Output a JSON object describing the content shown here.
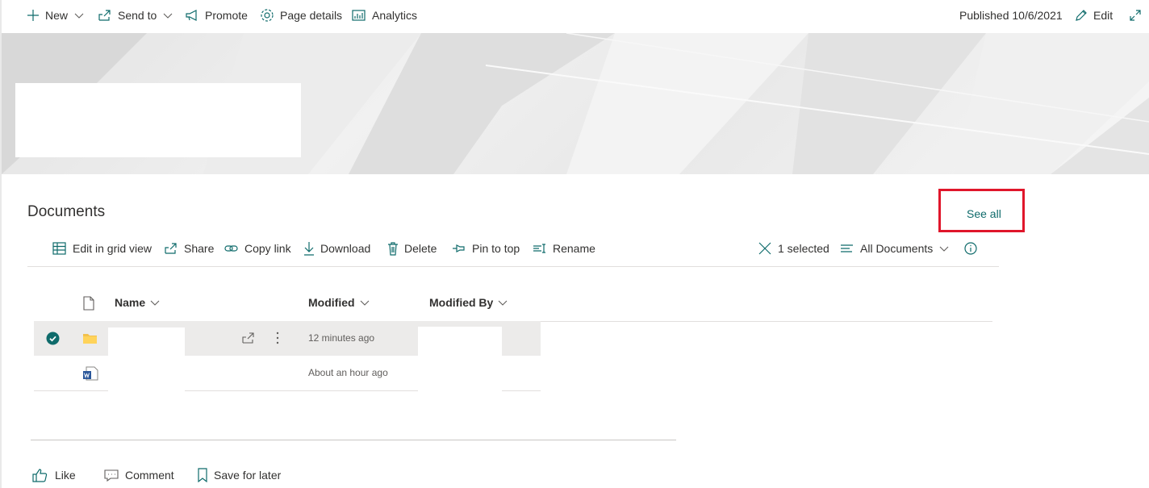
{
  "command_bar": {
    "new_label": "New",
    "send_to_label": "Send to",
    "promote_label": "Promote",
    "page_details_label": "Page details",
    "analytics_label": "Analytics",
    "published_label": "Published 10/6/2021",
    "edit_label": "Edit"
  },
  "documents": {
    "title": "Documents",
    "see_all_label": "See all",
    "toolbar": {
      "edit_grid_label": "Edit in grid view",
      "share_label": "Share",
      "copy_link_label": "Copy link",
      "download_label": "Download",
      "delete_label": "Delete",
      "pin_label": "Pin to top",
      "rename_label": "Rename",
      "selected_label": "1 selected",
      "view_label": "All Documents"
    },
    "columns": {
      "name": "Name",
      "modified": "Modified",
      "modified_by": "Modified By"
    },
    "rows": [
      {
        "type_icon": "folder-icon",
        "modified": "12 minutes ago",
        "selected": true
      },
      {
        "type_icon": "word-doc-icon",
        "modified": "About an hour ago",
        "selected": false
      }
    ]
  },
  "footer": {
    "like_label": "Like",
    "comment_label": "Comment",
    "save_label": "Save for later"
  },
  "colors": {
    "accent": "#0f6b6b",
    "highlight_box": "#e0162b",
    "selected_row": "#ecebea",
    "folder": "#f2c14e",
    "word": "#2b579a"
  }
}
